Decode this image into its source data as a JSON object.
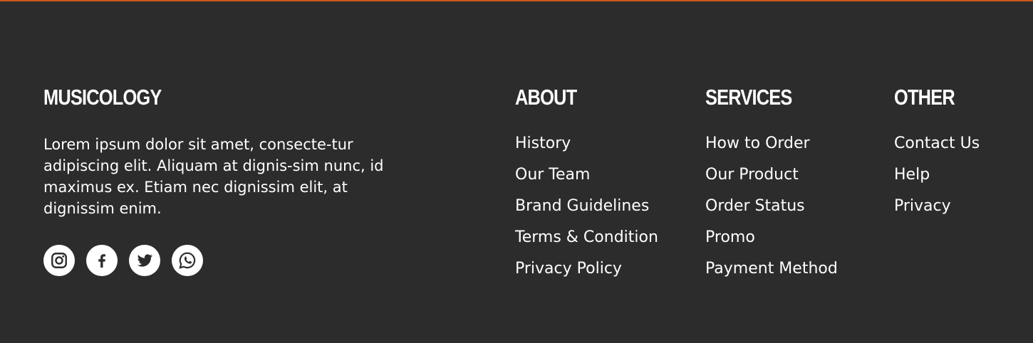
{
  "brand": {
    "name": "MUSICOLOGY",
    "description": "Lorem ipsum dolor sit amet, consecte-tur adipiscing elit. Aliquam at dignis-sim nunc, id maximus ex. Etiam nec dignissim elit, at dignissim enim."
  },
  "social": [
    {
      "icon": "instagram-icon"
    },
    {
      "icon": "facebook-icon"
    },
    {
      "icon": "twitter-icon"
    },
    {
      "icon": "whatsapp-icon"
    }
  ],
  "columns": {
    "about": {
      "title": "ABOUT",
      "links": [
        "History",
        "Our Team",
        "Brand Guidelines",
        "Terms & Condition",
        "Privacy Policy"
      ]
    },
    "services": {
      "title": "SERVICES",
      "links": [
        "How to Order",
        "Our Product",
        "Order Status",
        "Promo",
        "Payment Method"
      ]
    },
    "other": {
      "title": "OTHER",
      "links": [
        "Contact Us",
        "Help",
        "Privacy"
      ]
    }
  },
  "colors": {
    "background": "#2c2c2c",
    "accent_border": "#c85a19",
    "text": "#ffffff"
  }
}
